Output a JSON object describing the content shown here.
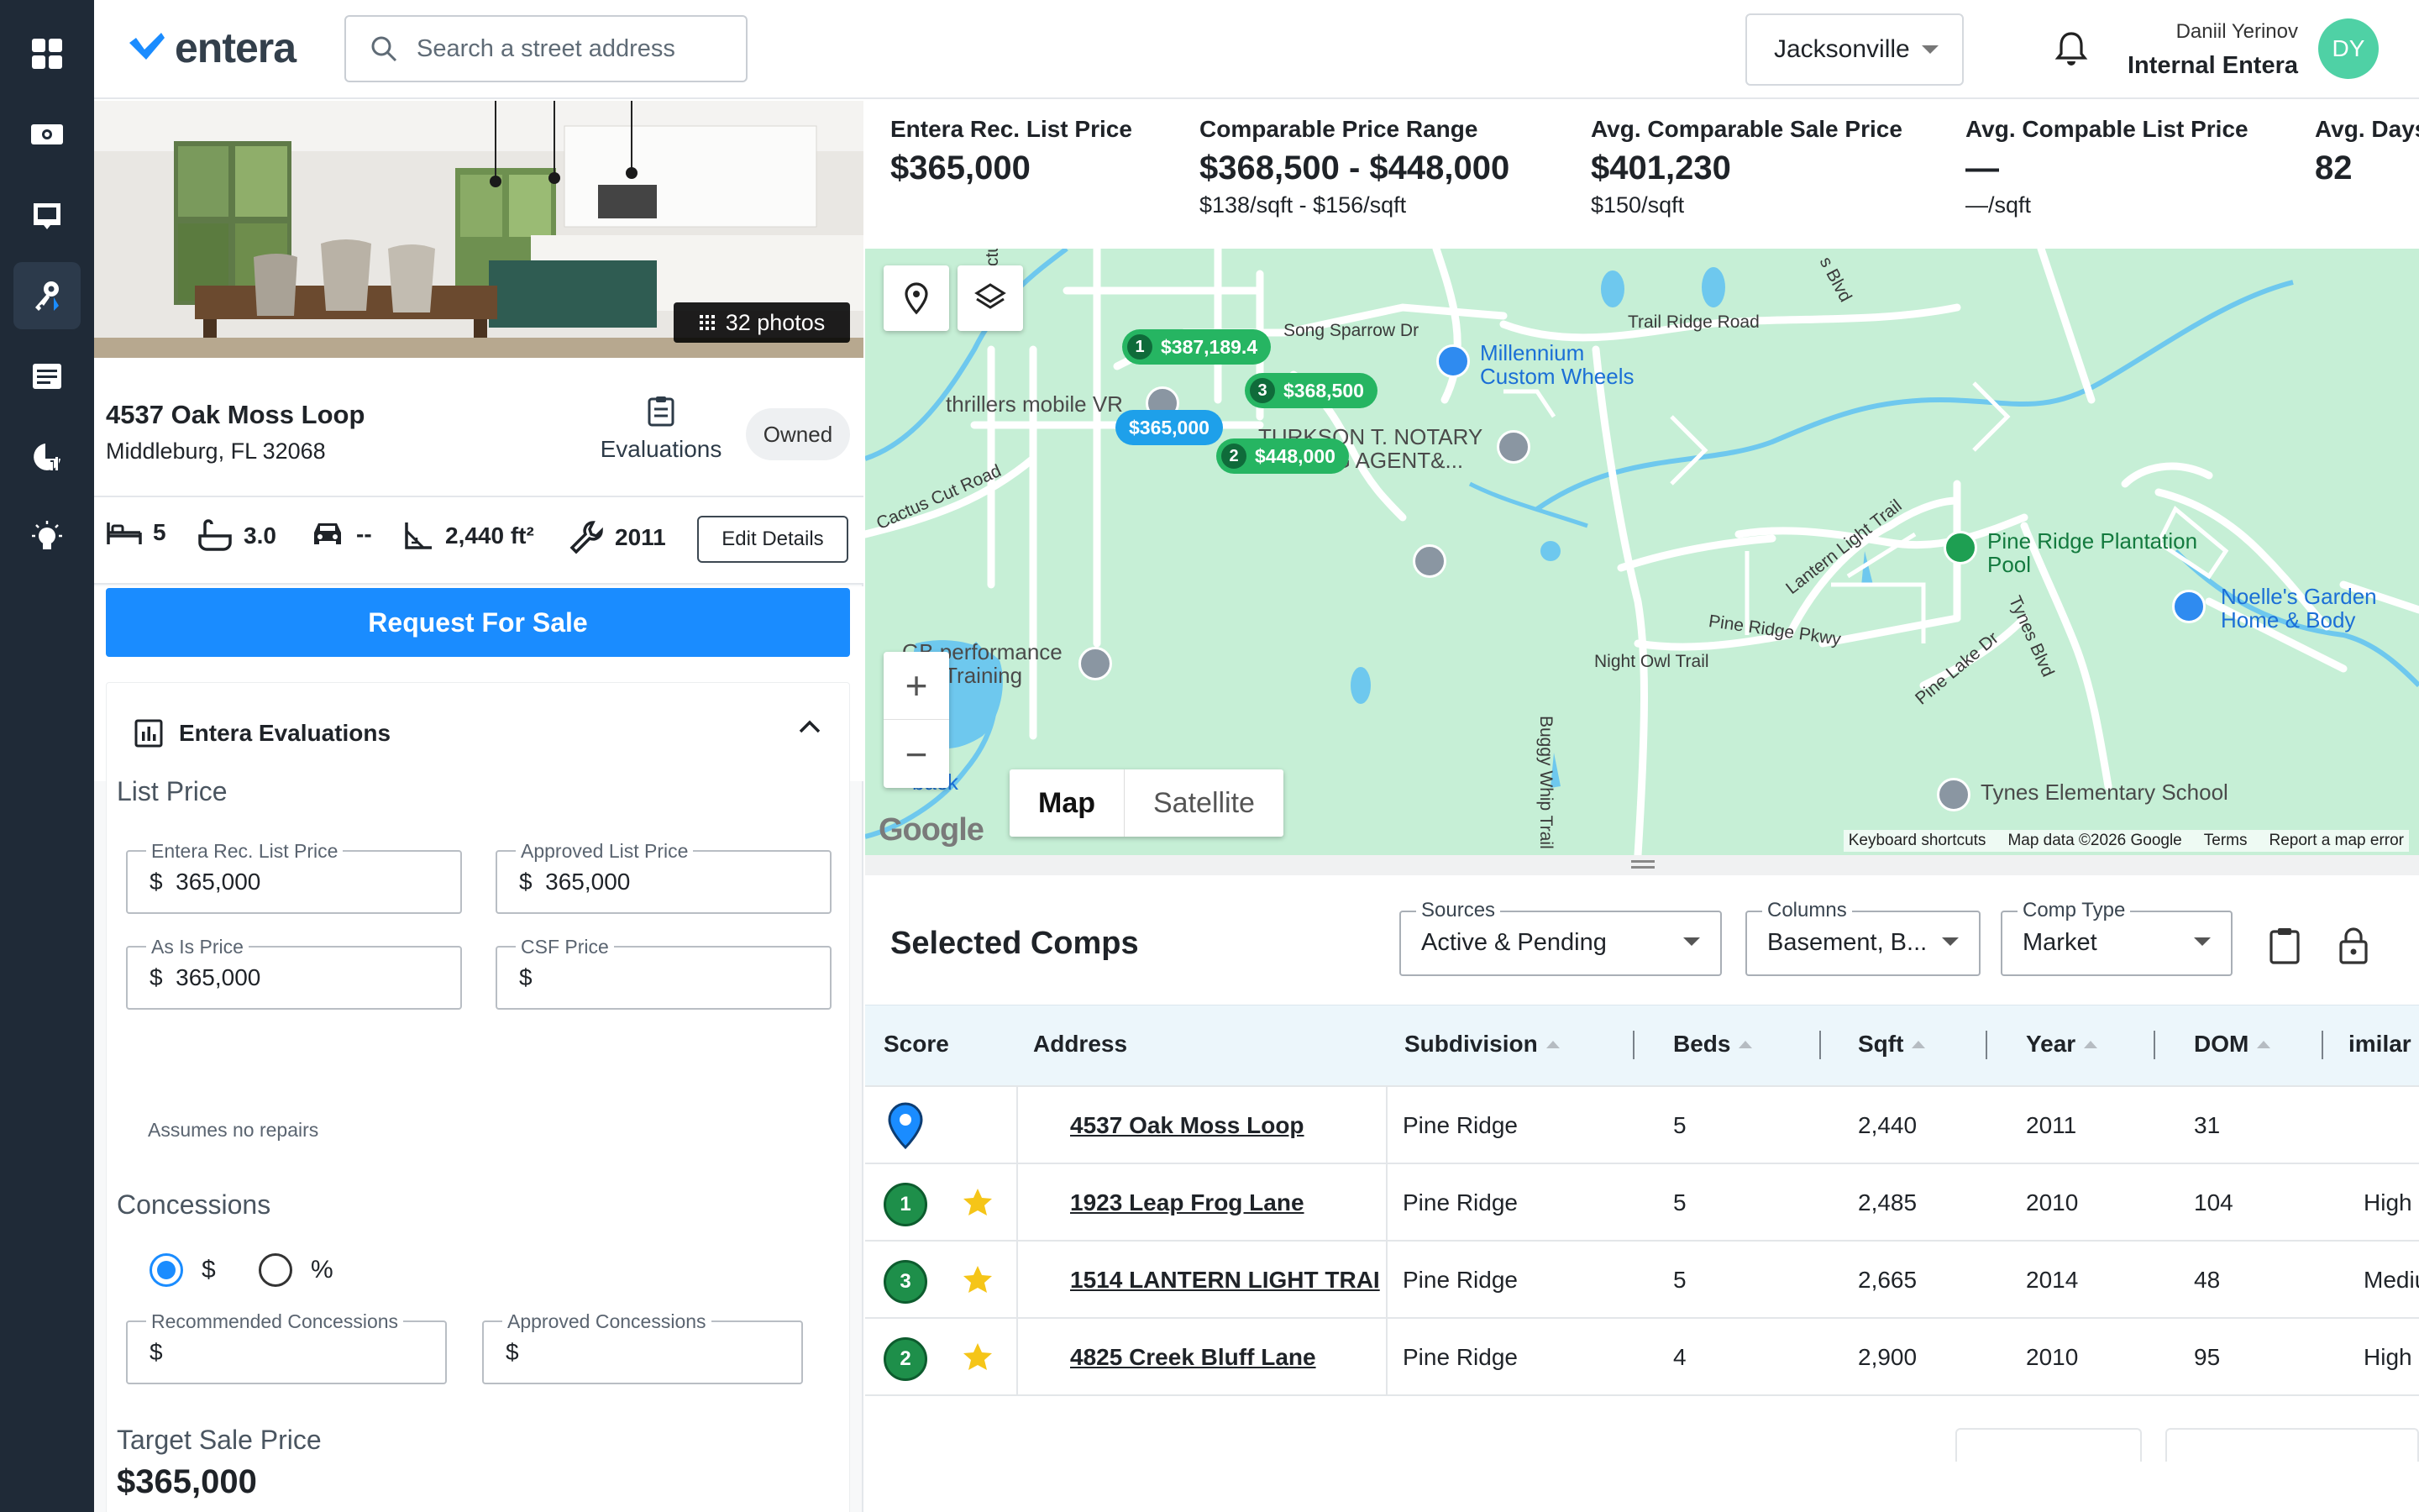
{
  "brand": {
    "name": "entera",
    "accent": "#1a8cff",
    "rail_bg": "#1f2a37"
  },
  "rail": {
    "items": [
      "dashboard-icon",
      "money-icon",
      "inbox-icon",
      "keys-icon",
      "list-icon",
      "chart-icon",
      "lightbulb-icon"
    ],
    "active_index": 3
  },
  "header": {
    "search_placeholder": "Search a street address",
    "city": "Jacksonville",
    "user_name": "Daniil Yerinov",
    "user_org": "Internal Entera",
    "avatar_initials": "DY"
  },
  "property": {
    "photos_label": "32 photos",
    "address_line1": "4537 Oak Moss Loop",
    "address_line2": "Middleburg, FL 32068",
    "evaluations_label": "Evaluations",
    "owned_label": "Owned",
    "beds": "5",
    "baths": "3.0",
    "garage": "--",
    "sqft": "2,440 ft²",
    "year": "2011",
    "edit_label": "Edit Details",
    "request_label": "Request For Sale"
  },
  "evaluation": {
    "title": "Entera Evaluations",
    "list_price_title": "List Price",
    "fields": {
      "rec_list": {
        "label": "Entera Rec. List Price",
        "currency": "$",
        "value": "365,000"
      },
      "approved_list": {
        "label": "Approved List Price",
        "currency": "$",
        "value": "365,000"
      },
      "as_is": {
        "label": "As Is Price",
        "currency": "$",
        "value": "365,000"
      },
      "csf": {
        "label": "CSF Price",
        "currency": "$",
        "value": ""
      },
      "rec_conc": {
        "label": "Recommended Concessions",
        "currency": "$",
        "value": ""
      },
      "approved_conc": {
        "label": "Approved Concessions",
        "currency": "$",
        "value": ""
      }
    },
    "hint": "Assumes no repairs",
    "concessions_title": "Concessions",
    "radio_dollar": "$",
    "radio_percent": "%",
    "target_title": "Target Sale Price",
    "target_value": "$365,000"
  },
  "stats": [
    {
      "label": "Entera Rec. List Price",
      "value": "$365,000",
      "sub": ""
    },
    {
      "label": "Comparable Price Range",
      "value": "$368,500 - $448,000",
      "sub": "$138/sqft - $156/sqft"
    },
    {
      "label": "Avg. Comparable Sale Price",
      "value": "$401,230",
      "sub": "$150/sqft"
    },
    {
      "label": "Avg. Compable List Price",
      "value": "—",
      "sub": "—/sqft"
    },
    {
      "label": "Avg. Days",
      "value": "82",
      "sub": ""
    }
  ],
  "map": {
    "pins": [
      {
        "num": "1",
        "price": "$387,189.4"
      },
      {
        "num": "3",
        "price": "$368,500"
      },
      {
        "num": "",
        "price": "$365,000"
      },
      {
        "num": "2",
        "price": "$448,000"
      }
    ],
    "pois": {
      "millennium": "Millennium Custom Wheels",
      "thrillers": "thrillers mobile VR",
      "notary": "TURKSON T. NOTARY SIGNING AGENT&...",
      "pine_ridge_pool": "Pine Ridge Plantation Pool",
      "noelles": "Noelle's Garden Home & Body",
      "gb_perf": "GB performance and Training",
      "tynes": "Tynes Elementary School",
      "back": "back"
    },
    "roads": {
      "song_sparrow": "Song Sparrow Dr",
      "trail_ridge": "Trail Ridge Road",
      "cactus_cut": "Cactus Cut Road",
      "cactus": "Cactus",
      "lantern": "Lantern Light Trail",
      "pine_ridge_pkwy": "Pine Ridge Pkwy",
      "night_owl": "Night Owl Trail",
      "buggy_whip": "Buggy Whip Trail",
      "pine_lake": "Pine Lake Dr",
      "tynes_blvd": "Tynes Blvd",
      "blvd": "s Blvd"
    },
    "tab_map": "Map",
    "tab_satellite": "Satellite",
    "google": "Google",
    "footer": [
      "Keyboard shortcuts",
      "Map data ©2026 Google",
      "Terms",
      "Report a map error"
    ]
  },
  "comps": {
    "title": "Selected Comps",
    "sources": {
      "label": "Sources",
      "value": "Active & Pending"
    },
    "columns": {
      "label": "Columns",
      "value": "Basement, B..."
    },
    "comp_type": {
      "label": "Comp Type",
      "value": "Market"
    },
    "headers": [
      "Score",
      "Address",
      "Subdivision",
      "Beds",
      "Sqft",
      "Year",
      "DOM",
      "imilar"
    ],
    "rows": [
      {
        "score": "",
        "address": "4537 Oak Moss Loop",
        "subdivision": "Pine Ridge",
        "beds": "5",
        "sqft": "2,440",
        "year": "2011",
        "dom": "31",
        "similar": ""
      },
      {
        "score": "1",
        "address": "1923 Leap Frog Lane",
        "subdivision": "Pine Ridge",
        "beds": "5",
        "sqft": "2,485",
        "year": "2010",
        "dom": "104",
        "similar": "High"
      },
      {
        "score": "3",
        "address": "1514 LANTERN LIGHT TRAI",
        "subdivision": "Pine Ridge",
        "beds": "5",
        "sqft": "2,665",
        "year": "2014",
        "dom": "48",
        "similar": "Mediu"
      },
      {
        "score": "2",
        "address": "4825 Creek Bluff Lane",
        "subdivision": "Pine Ridge",
        "beds": "4",
        "sqft": "2,900",
        "year": "2010",
        "dom": "95",
        "similar": "High"
      }
    ]
  }
}
